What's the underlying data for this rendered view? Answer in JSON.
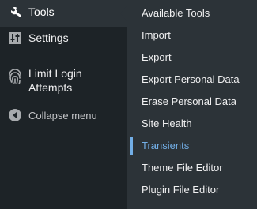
{
  "sidebar": {
    "items": [
      {
        "label": "Tools",
        "icon": "wrench-icon"
      },
      {
        "label": "Settings",
        "icon": "settings-sliders-icon"
      },
      {
        "label": "Limit Login Attempts",
        "icon": "fingerprint-icon"
      },
      {
        "label": "Collapse menu",
        "icon": "collapse-arrow-icon"
      }
    ]
  },
  "submenu": {
    "items": [
      {
        "label": "Available Tools"
      },
      {
        "label": "Import"
      },
      {
        "label": "Export"
      },
      {
        "label": "Export Personal Data"
      },
      {
        "label": "Erase Personal Data"
      },
      {
        "label": "Site Health"
      },
      {
        "label": "Transients",
        "active": true
      },
      {
        "label": "Theme File Editor"
      },
      {
        "label": "Plugin File Editor"
      }
    ]
  },
  "colors": {
    "sidebar_bg": "#1d2327",
    "submenu_bg": "#2c3338",
    "text": "#f0f0f1",
    "active": "#72aee6",
    "icon": "#a7aaad"
  }
}
